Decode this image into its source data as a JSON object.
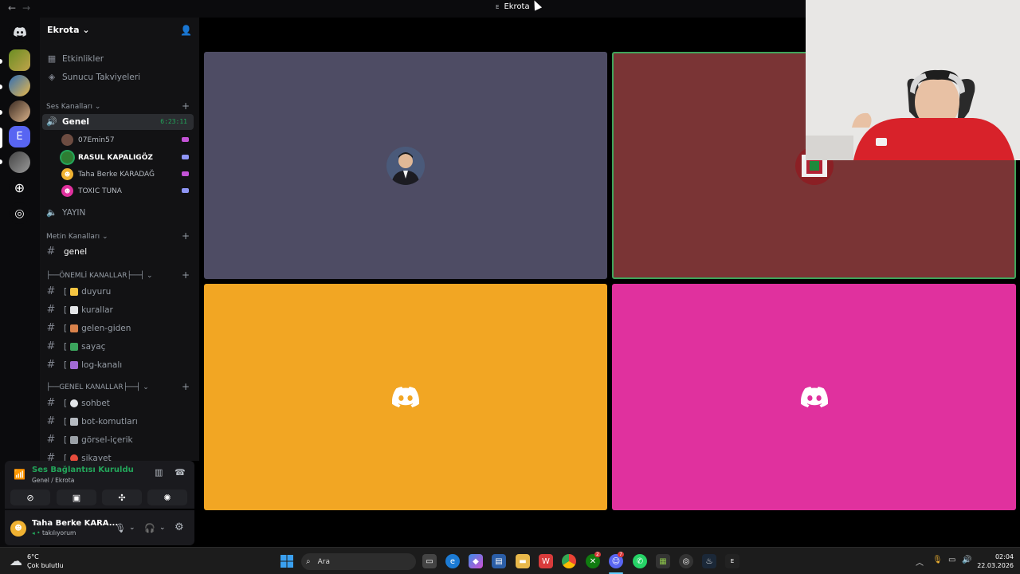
{
  "window": {
    "title": "Ekrota",
    "title_prefix": "E",
    "back": "←",
    "forward": "→"
  },
  "rail": {
    "active_initial": "E"
  },
  "server": {
    "name": "Ekrota",
    "dropdown": "⌄"
  },
  "sidebar": {
    "top_items": [
      {
        "label": "Etkinlikler",
        "icon": "calendar-icon"
      },
      {
        "label": "Sunucu Takviyeleri",
        "icon": "boost-icon"
      }
    ],
    "voice_category": "Ses Kanalları",
    "voice_channels": [
      {
        "name": "Genel",
        "timer": "6:23:11"
      },
      {
        "name": "YAYIN"
      }
    ],
    "members": [
      {
        "name": "07Emin57"
      },
      {
        "name": "RASUL KAPALIGÖZ"
      },
      {
        "name": "Taha Berke KARADAĞ"
      },
      {
        "name": "TOXIC TUNA"
      }
    ],
    "text_category": "Metin Kanalları",
    "text_channels": [
      {
        "name": "genel"
      }
    ],
    "important_category": "├──ÖNEMLİ KANALLAR├──┤",
    "important_channels": [
      {
        "name": "duyuru",
        "prefix": "[",
        "emoji_color": "#f5c542"
      },
      {
        "name": "kurallar",
        "prefix": "[",
        "emoji_color": "#e3e5e8"
      },
      {
        "name": "gelen-giden",
        "prefix": "[",
        "emoji_color": "#d9824b"
      },
      {
        "name": "sayaç",
        "prefix": "[",
        "emoji_color": "#3ba55d"
      },
      {
        "name": "log-kanalı",
        "prefix": "[",
        "emoji_color": "#a06ad4"
      }
    ],
    "general_category": "├──GENEL KANALLAR├──┤",
    "general_channels": [
      {
        "name": "sohbet",
        "prefix": "[",
        "emoji_color": "#e3e5e8"
      },
      {
        "name": "bot-komutları",
        "prefix": "[",
        "emoji_color": "#b5bac1"
      },
      {
        "name": "görsel-içerik",
        "prefix": "[",
        "emoji_color": "#9aa0a6"
      },
      {
        "name": "şikayet",
        "prefix": "[",
        "emoji_color": "#e74c3c"
      }
    ]
  },
  "voice_panel": {
    "title": "Ses Bağlantısı Kuruldu",
    "subtitle": "Genel / Ekrota"
  },
  "user_panel": {
    "name": "Taha Berke KARA...",
    "status": "takılıyorum"
  },
  "taskbar": {
    "temperature": "6°C",
    "condition": "Çok bulutlu",
    "search_placeholder": "Ara",
    "time": "02:04",
    "date": "22.03.2026",
    "discord_badge": "7",
    "xbox_badge": "2"
  },
  "colors": {
    "tile_gray": "#4e4c64",
    "tile_red": "#7a3435",
    "tile_orange": "#f2a623",
    "tile_pink": "#e0319e",
    "speaking_border": "#3fa55b",
    "connected_green": "#23a55a"
  }
}
